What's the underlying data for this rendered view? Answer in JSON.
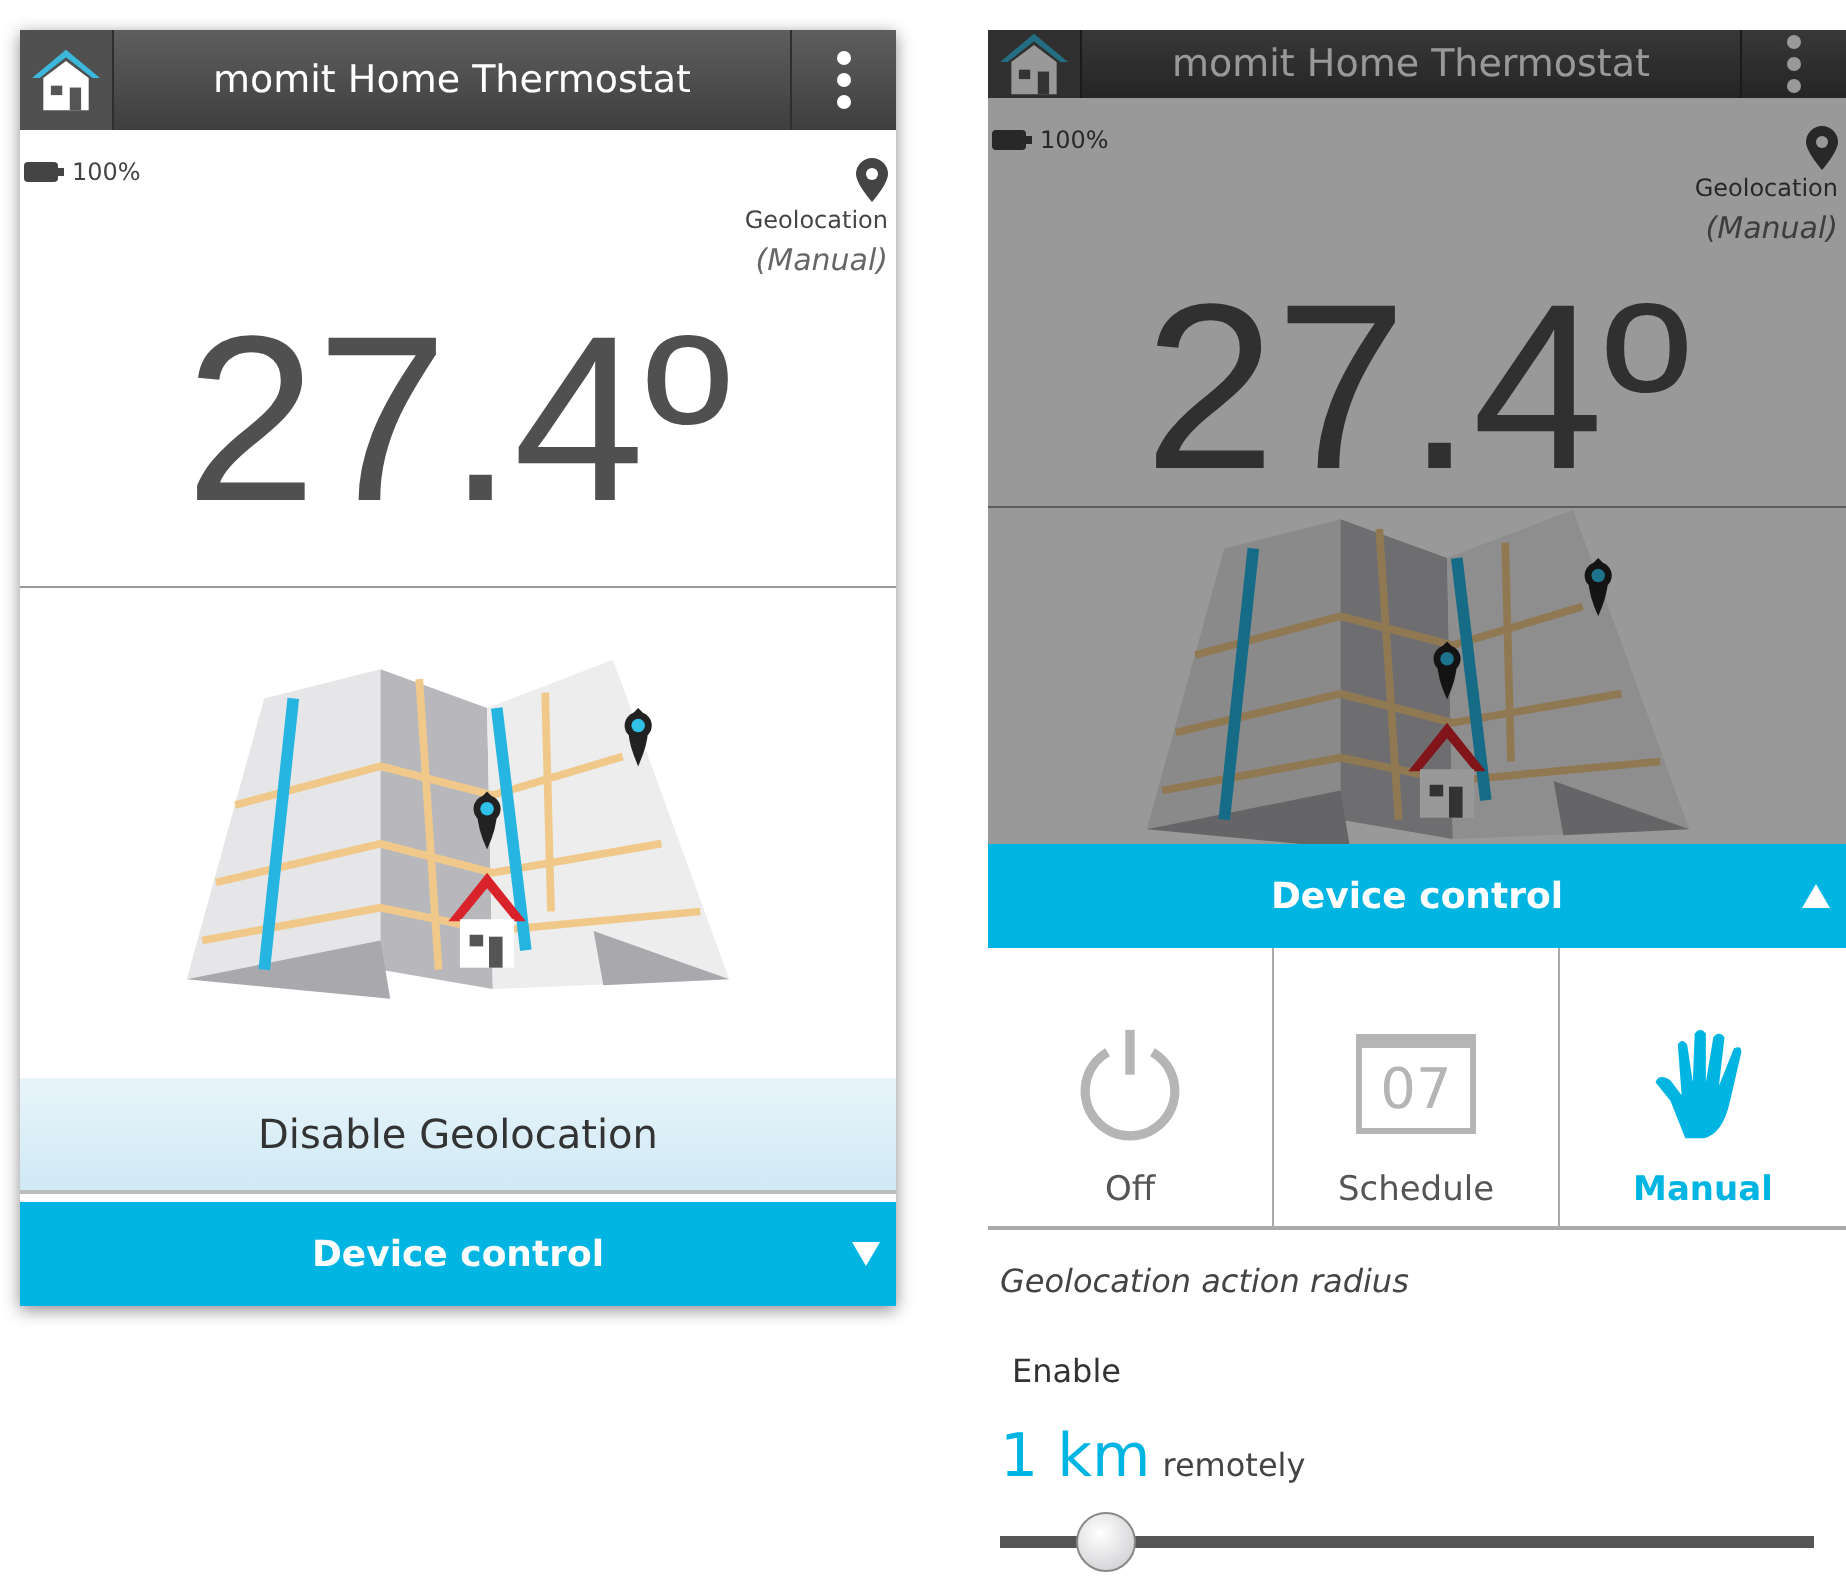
{
  "screens": [
    {
      "dimmed": false,
      "header": {
        "title": "momit Home Thermostat"
      },
      "battery": "100%",
      "geolocation": {
        "label": "Geolocation",
        "mode": "(Manual)"
      },
      "temperature": "27.4º",
      "disable_button": "Disable Geolocation",
      "device_control": {
        "title": "Device control",
        "expanded": false
      }
    },
    {
      "dimmed": true,
      "header": {
        "title": "momit Home Thermostat"
      },
      "battery": "100%",
      "geolocation": {
        "label": "Geolocation",
        "mode": "(Manual)"
      },
      "temperature": "27.4º",
      "device_control": {
        "title": "Device control",
        "expanded": true,
        "modes": [
          {
            "kind": "power",
            "label": "Off",
            "selected": false
          },
          {
            "kind": "calendar",
            "day": "07",
            "label": "Schedule",
            "selected": false
          },
          {
            "kind": "hand",
            "label": "Manual",
            "selected": true
          }
        ]
      },
      "radius": {
        "title": "Geolocation action radius",
        "enable": "Enable",
        "value": "1 km",
        "suffix": "remotely",
        "level": 0.13
      }
    }
  ]
}
